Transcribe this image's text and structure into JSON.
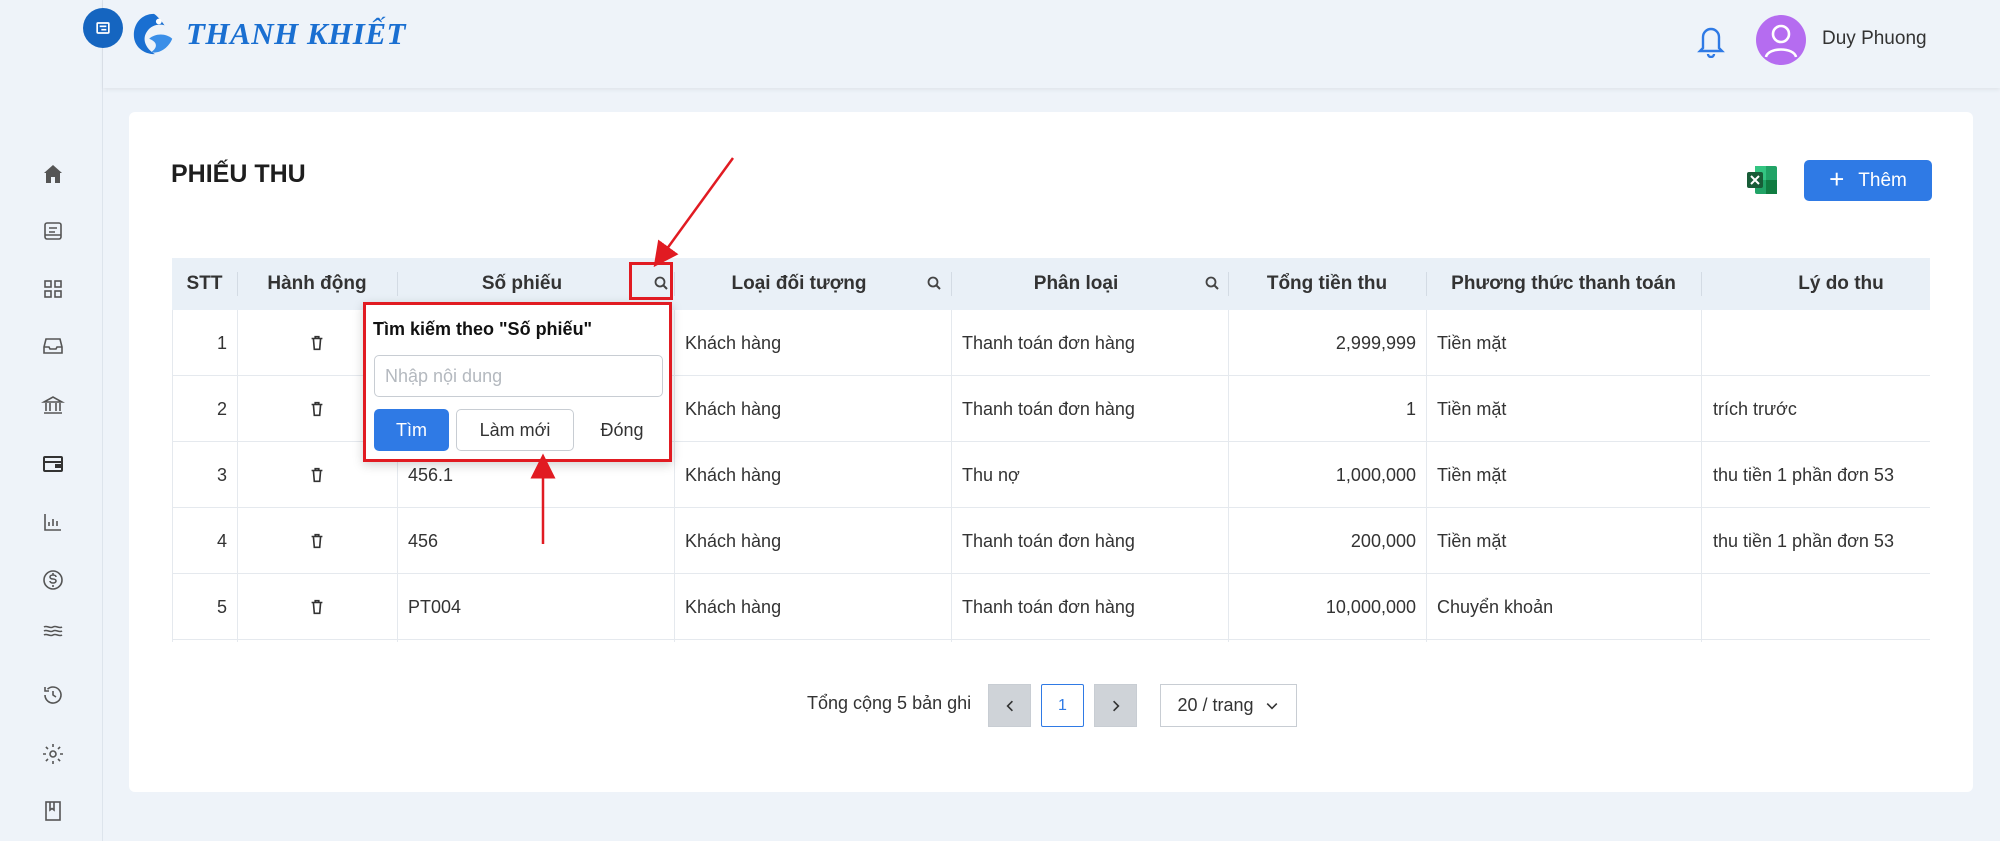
{
  "app": {
    "brand": "THANH KHIẾT",
    "user": "Duy Phuong"
  },
  "sidebar": {
    "items": [
      {
        "icon": "home-icon"
      },
      {
        "icon": "receipt-icon"
      },
      {
        "icon": "grid-icon"
      },
      {
        "icon": "inbox-icon"
      },
      {
        "icon": "bank-icon"
      },
      {
        "icon": "wallet-icon"
      },
      {
        "icon": "bar-chart-icon"
      },
      {
        "icon": "dollar-icon"
      },
      {
        "icon": "waves-icon"
      },
      {
        "icon": "history-icon"
      },
      {
        "icon": "gear-icon"
      },
      {
        "icon": "book-icon"
      }
    ]
  },
  "page": {
    "title": "PHIẾU THU",
    "add_label": "Thêm"
  },
  "table": {
    "columns": {
      "stt": "STT",
      "action": "Hành động",
      "code": "Số phiếu",
      "object_type": "Loại đối tượng",
      "category": "Phân loại",
      "total": "Tổng tiền thu",
      "method": "Phương thức thanh toán",
      "reason": "Lý do thu"
    },
    "rows": [
      {
        "stt": "1",
        "code": "",
        "object_type": "Khách hàng",
        "category": "Thanh toán đơn hàng",
        "total": "2,999,999",
        "method": "Tiền mặt",
        "reason": ""
      },
      {
        "stt": "2",
        "code": "",
        "object_type": "Khách hàng",
        "category": "Thanh toán đơn hàng",
        "total": "1",
        "method": "Tiền mặt",
        "reason": "trích trước"
      },
      {
        "stt": "3",
        "code": "456.1",
        "object_type": "Khách hàng",
        "category": "Thu nợ",
        "total": "1,000,000",
        "method": "Tiền mặt",
        "reason": "thu tiền 1 phần đơn 53"
      },
      {
        "stt": "4",
        "code": "456",
        "object_type": "Khách hàng",
        "category": "Thanh toán đơn hàng",
        "total": "200,000",
        "method": "Tiền mặt",
        "reason": "thu tiền 1 phần đơn 53"
      },
      {
        "stt": "5",
        "code": "PT004",
        "object_type": "Khách hàng",
        "category": "Thanh toán đơn hàng",
        "total": "10,000,000",
        "method": "Chuyển khoản",
        "reason": ""
      }
    ]
  },
  "pagination": {
    "total_text": "Tổng cộng 5 bản ghi",
    "current_page": "1",
    "page_size": "20 / trang"
  },
  "search_popup": {
    "title": "Tìm kiếm theo \"Số phiếu\"",
    "placeholder": "Nhập nội dung",
    "find_label": "Tìm",
    "reset_label": "Làm mới",
    "close_label": "Đóng"
  },
  "colors": {
    "primary": "#2f7ae5",
    "annotation": "#e11b22",
    "avatar": "#b56cf0"
  }
}
